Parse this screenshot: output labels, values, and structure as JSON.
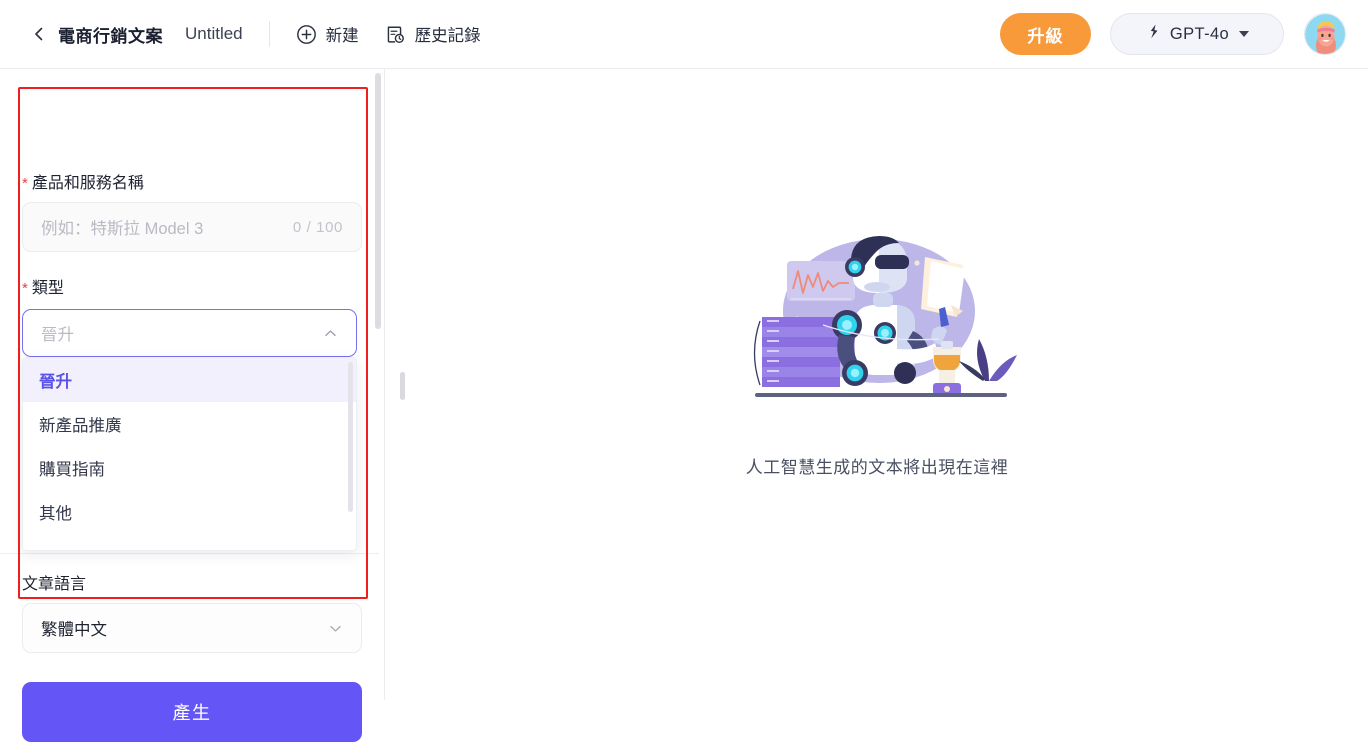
{
  "header": {
    "back_icon": "chevron-left-icon",
    "app_title": "電商行銷文案",
    "doc_title": "Untitled",
    "new_label": "新建",
    "new_icon": "plus-circle-icon",
    "history_label": "歷史記錄",
    "history_icon": "document-clock-icon",
    "upgrade_label": "升級",
    "model_name": "GPT-4o",
    "model_icon": "lightning-bolt-icon",
    "model_caret": "caret-down-icon",
    "avatar": "user-avatar"
  },
  "form": {
    "product_field": {
      "required_mark": "*",
      "label": "產品和服務名稱",
      "placeholder": "例如：特斯拉 Model 3",
      "value": "",
      "counter": "0 / 100"
    },
    "type_field": {
      "required_mark": "*",
      "label": "類型",
      "placeholder": "晉升",
      "value": "",
      "chevron": "chevron-up-icon",
      "options": [
        {
          "label": "晉升",
          "selected": true
        },
        {
          "label": "新產品推廣",
          "selected": false
        },
        {
          "label": "購買指南",
          "selected": false
        },
        {
          "label": "其他",
          "selected": false
        }
      ]
    },
    "language_field": {
      "label": "文章語言",
      "value": "繁體中文",
      "chevron": "chevron-down-icon"
    },
    "generate_label": "產生"
  },
  "main": {
    "empty_caption": "人工智慧生成的文本將出現在這裡",
    "illustration": "ai-robot-illustration"
  },
  "colors": {
    "accent_purple": "#6355f6",
    "dropdown_selected_text": "#5a52e8",
    "dropdown_selected_bg": "#f1f0fc",
    "upgrade_orange": "#f8993a",
    "required_red": "#e8423f",
    "highlight_red": "#f01f1f"
  }
}
